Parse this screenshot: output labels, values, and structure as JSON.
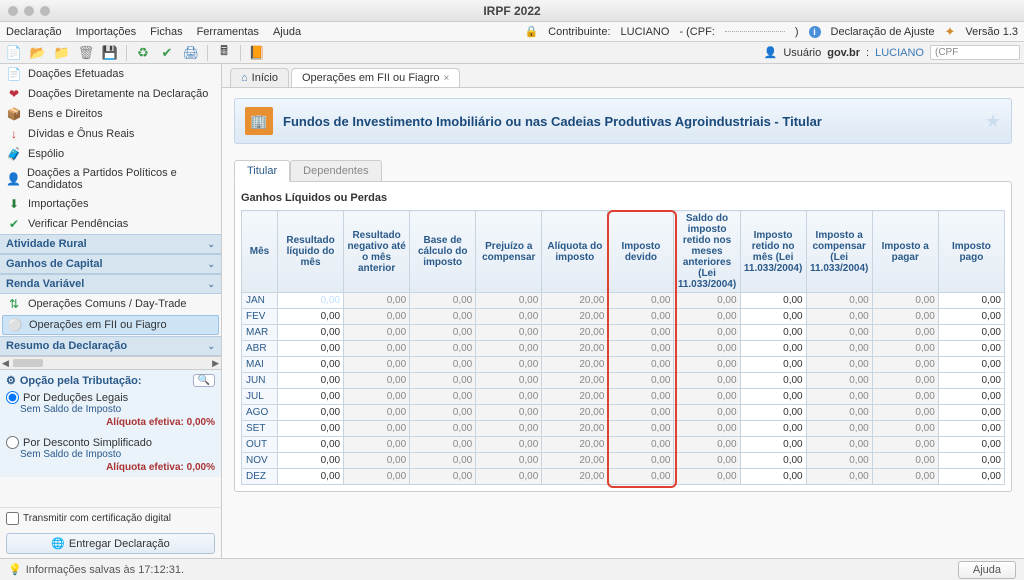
{
  "title": "IRPF 2022",
  "menu": {
    "items": [
      "Declaração",
      "Importações",
      "Fichas",
      "Ferramentas",
      "Ajuda"
    ]
  },
  "topRight": {
    "contribuinte_label": "Contribuinte:",
    "contribuinte_name": "LUCIANO",
    "cpf_label": "- (CPF:",
    "cpf_close": ")",
    "declaracao": "Declaração de Ajuste",
    "versao": "Versão 1.3"
  },
  "userbar": {
    "label": "Usuário",
    "govbr": "gov.br",
    "name": "LUCIANO",
    "cpf_placeholder": "(CPF"
  },
  "sidebar": {
    "items": [
      {
        "icon": "📄",
        "label": "Doações Efetuadas",
        "color": "#2a7a3a"
      },
      {
        "icon": "❤",
        "label": "Doações Diretamente na Declaração",
        "color": "#c03040"
      },
      {
        "icon": "📦",
        "label": "Bens e Direitos",
        "color": "#b08030"
      },
      {
        "icon": "↓",
        "label": "Dívidas e Ônus Reais",
        "color": "#c03030"
      },
      {
        "icon": "🧳",
        "label": "Espólio",
        "color": "#8a5a2a"
      },
      {
        "icon": "👤",
        "label": "Doações a Partidos Políticos e Candidatos",
        "color": "#555"
      },
      {
        "icon": "⬇",
        "label": "Importações",
        "color": "#2a7a3a"
      },
      {
        "icon": "✔",
        "label": "Verificar Pendências",
        "color": "#2a9a4a"
      }
    ],
    "headers": [
      "Atividade Rural",
      "Ganhos de Capital",
      "Renda Variável"
    ],
    "rv_items": [
      {
        "icon": "⇅",
        "label": "Operações Comuns / Day-Trade",
        "color": "#2a9a4a"
      },
      {
        "icon": "⚪",
        "label": "Operações em FII ou Fiagro",
        "color": "#aaa",
        "selected": true
      }
    ],
    "resumo_header": "Resumo da Declaração",
    "tributacao": {
      "title": "Opção pela Tributação:",
      "opt1": "Por Deduções Legais",
      "sub1": "Sem Saldo de Imposto",
      "aliq": "Alíquota efetiva: 0,00%",
      "opt2": "Por Desconto Simplificado",
      "sub2": "Sem Saldo de Imposto"
    },
    "transmitir": "Transmitir com certificação digital",
    "entregar": "Entregar Declaração"
  },
  "tabs": {
    "home": "Início",
    "t1": "Operações em FII ou Fiagro"
  },
  "page": {
    "title": "Fundos de Investimento Imobiliário ou nas Cadeias Produtivas Agroindustriais - Titular",
    "inner_tabs": [
      "Titular",
      "Dependentes"
    ],
    "section": "Ganhos Líquidos ou Perdas"
  },
  "table": {
    "headers": [
      "Mês",
      "Resultado líquido do mês",
      "Resultado negativo até o mês anterior",
      "Base de cálculo do imposto",
      "Prejuízo a compensar",
      "Alíquota do imposto",
      "Imposto devido",
      "Saldo do imposto retido nos meses anteriores (Lei 11.033/2004)",
      "Imposto retido no mês (Lei 11.033/2004)",
      "Imposto a compensar (Lei 11.033/2004)",
      "Imposto a pagar",
      "Imposto pago"
    ],
    "months": [
      "JAN",
      "FEV",
      "MAR",
      "ABR",
      "MAI",
      "JUN",
      "JUL",
      "AGO",
      "SET",
      "OUT",
      "NOV",
      "DEZ"
    ]
  },
  "status": {
    "text": "Informações salvas às 17:12:31.",
    "ajuda": "Ajuda"
  }
}
